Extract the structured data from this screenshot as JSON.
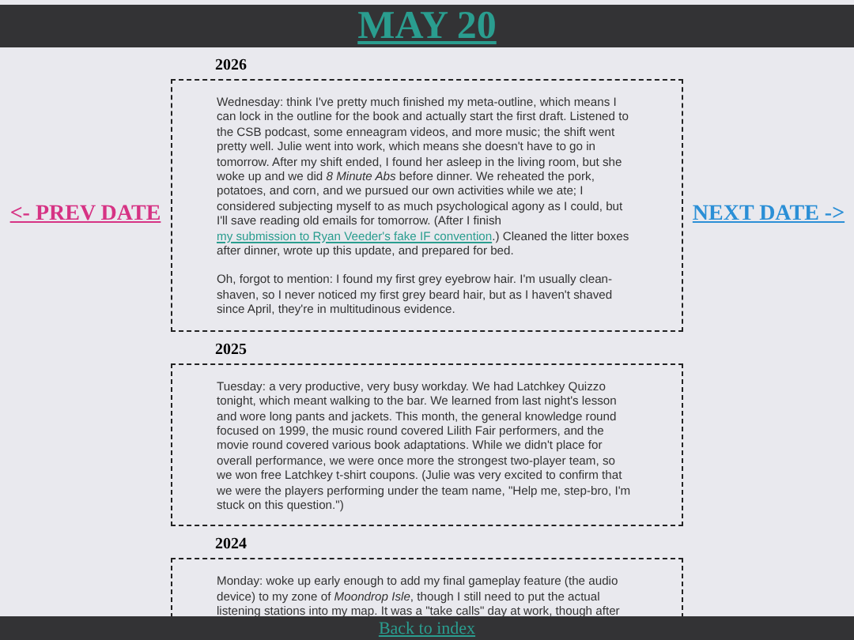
{
  "header": {
    "title": "MAY 20"
  },
  "nav": {
    "prev": "<- PREV DATE",
    "next": "NEXT DATE ->"
  },
  "entries": [
    {
      "year": "2026",
      "paragraphs": [
        [
          {
            "kind": "text",
            "text": "Wednesday: think I've pretty much finished my meta-outline, which means I can lock in the outline for the book and actually start the first draft. Listened to the CSB podcast, some enneagram videos, and more music; the shift went pretty well. Julie went into work, which means she doesn't have to go in tomorrow. After my shift ended, I found her asleep in the living room, but she woke up and we did *8 Minute Abs* before dinner. We reheated the pork, potatoes, and corn, and we pursued our own activities while we ate; I considered subjecting myself to as much psychological agony as I could, but I'll save reading old emails for tomorrow. (After I finish "
          },
          {
            "kind": "link",
            "text": "my submission to Ryan Veeder's fake IF convention"
          },
          {
            "kind": "text",
            "text": ".) Cleaned the litter boxes after dinner, wrote up this update, and prepared for bed."
          }
        ],
        [
          {
            "kind": "text",
            "text": "Oh, forgot to mention: I found my first grey eyebrow hair. I'm usually clean-shaven, so I never noticed my first grey beard hair, but as I haven't shaved since April, they're in multitudinous evidence."
          }
        ]
      ]
    },
    {
      "year": "2025",
      "paragraphs": [
        [
          {
            "kind": "text",
            "text": "Tuesday: a very productive, very busy workday. We had Latchkey Quizzo tonight, which meant walking to the bar. We learned from last night's lesson and wore long pants and jackets. This month, the general knowledge round focused on 1999, the music round covered Lilith Fair performers, and the movie round covered various book adaptations. While we didn't place for overall performance, we were once more the strongest two-player team, so we won free Latchkey t-shirt coupons. (Julie was very excited to confirm that we were the players performing under the team name, \"Help me, step-bro, I'm stuck on this question.\")"
          }
        ]
      ]
    },
    {
      "year": "2024",
      "paragraphs": [
        [
          {
            "kind": "text",
            "text": "Monday: woke up early enough to add my final gameplay feature (the audio device) to my zone of *Moondrop Isle*, though I still need to put the actual listening stations into my map. It was a \"take calls\" day at work, though after"
          }
        ]
      ]
    }
  ],
  "footer": {
    "link": "Back to index"
  }
}
